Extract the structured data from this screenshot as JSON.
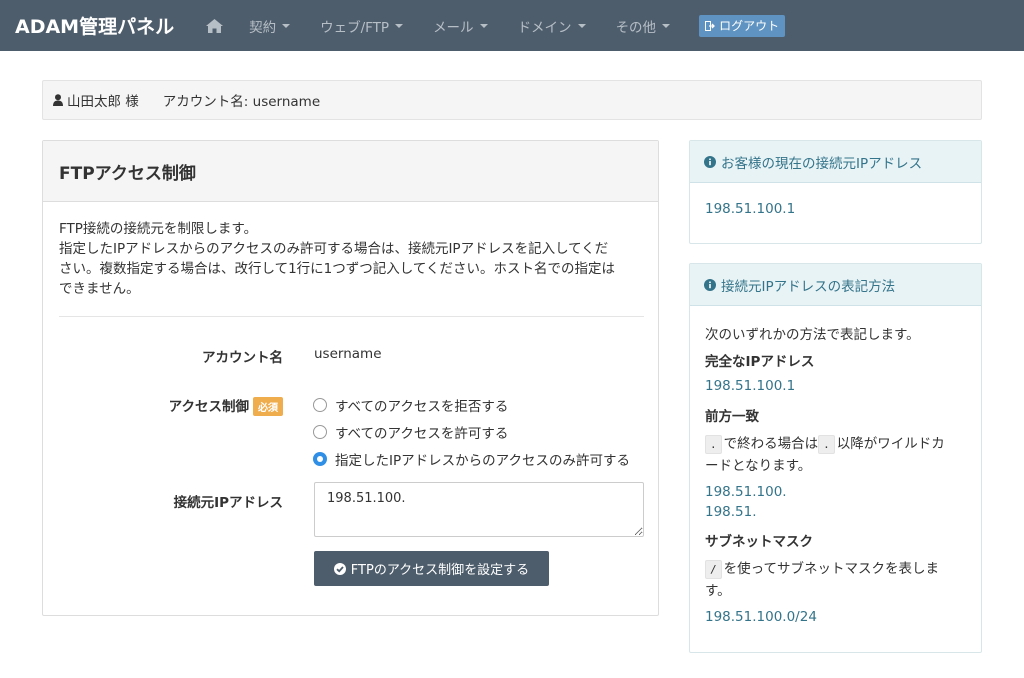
{
  "navbar": {
    "brand": "ADAM管理パネル",
    "items": [
      {
        "label": "契約"
      },
      {
        "label": "ウェブ/FTP"
      },
      {
        "label": "メール"
      },
      {
        "label": "ドメイン"
      },
      {
        "label": "その他"
      }
    ],
    "logout_label": "ログアウト"
  },
  "account_bar": {
    "user_name": "山田太郎 様",
    "account_label": "アカウント名: username"
  },
  "main_panel": {
    "title": "FTPアクセス制御",
    "description": [
      "FTP接続の接続元を制限します。",
      "指定したIPアドレスからのアクセスのみ許可する場合は、接続元IPアドレスを記入してくだ",
      "さい。複数指定する場合は、改行して1行に1つずつ記入してください。ホスト名での指定は",
      "できません。"
    ],
    "account_name_label": "アカウント名",
    "account_name_value": "username",
    "access_control_label": "アクセス制御",
    "required_badge": "必須",
    "radio_options": [
      {
        "label": "すべてのアクセスを拒否する",
        "checked": false
      },
      {
        "label": "すべてのアクセスを許可する",
        "checked": false
      },
      {
        "label": "指定したIPアドレスからのアクセスのみ許可する",
        "checked": true
      }
    ],
    "ip_label": "接続元IPアドレス",
    "ip_value": "198.51.100.",
    "submit_label": "FTPのアクセス制御を設定する"
  },
  "ip_panel": {
    "title": "お客様の現在の接続元IPアドレス",
    "ip": "198.51.100.1"
  },
  "format_panel": {
    "title": "接続元IPアドレスの表記方法",
    "intro": "次のいずれかの方法で表記します。",
    "full_ip_heading": "完全なIPアドレス",
    "full_ip_example": "198.51.100.1",
    "prefix_heading": "前方一致",
    "prefix_code_1": ".",
    "prefix_text_1": "で終わる場合は",
    "prefix_code_2": ".",
    "prefix_text_2": "以降がワイルドカ",
    "prefix_text_3": "ードとなります。",
    "prefix_example_1": "198.51.100.",
    "prefix_example_2": "198.51.",
    "subnet_heading": "サブネットマスク",
    "subnet_code": "/",
    "subnet_text_1": "を使ってサブネットマスクを表しま",
    "subnet_text_2": "す。",
    "subnet_example": "198.51.100.0/24"
  },
  "colors": {
    "navbar_bg": "#4e5d6c",
    "info_text": "#34748a",
    "required_badge": "#f0ad4e",
    "logout_button": "#5f93c2"
  }
}
